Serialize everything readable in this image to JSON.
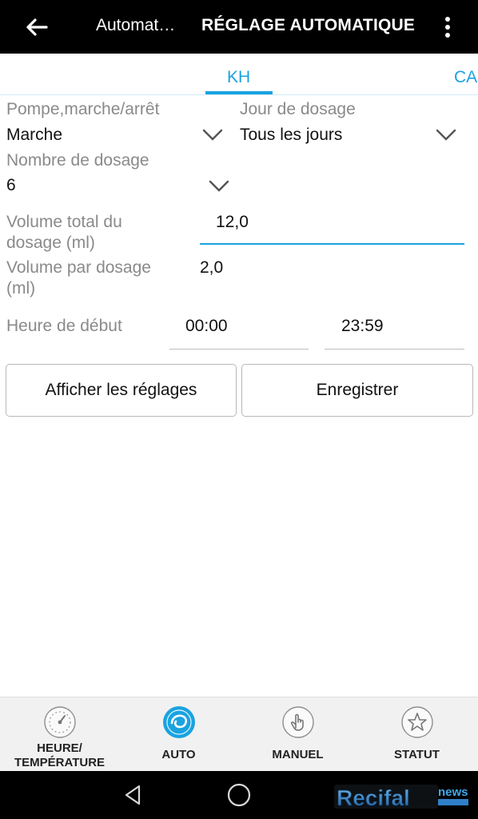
{
  "appbar": {
    "subtitle": "Automat…",
    "title": "RÉGLAGE AUTOMATIQUE",
    "back_icon": "arrow-left-icon",
    "more_icon": "more-vertical-icon"
  },
  "tabs": [
    {
      "label": "KH",
      "selected": true
    },
    {
      "label": "CA",
      "selected": false
    }
  ],
  "form": {
    "pump": {
      "label": "Pompe,marche/arrêt",
      "value": "Marche"
    },
    "day": {
      "label": "Jour de dosage",
      "value": "Tous les jours"
    },
    "count": {
      "label": "Nombre de dosage",
      "value": "6"
    },
    "total_volume": {
      "label_line1": "Volume total du",
      "label_line2": "dosage (ml)",
      "value": "12,0"
    },
    "per_dose": {
      "label_line1": "Volume par dosage",
      "label_line2": "(ml)",
      "value": "2,0"
    },
    "start_time": {
      "label": "Heure de début",
      "from": "00:00",
      "to": "23:59"
    }
  },
  "buttons": {
    "show_settings": "Afficher les réglages",
    "save": "Enregistrer"
  },
  "bottom_nav": [
    {
      "line1": "HEURE/",
      "line2": "TEMPÉRATURE",
      "icon": "gauge-icon",
      "active": false
    },
    {
      "line1": "AUTO",
      "line2": "",
      "icon": "auto-swirl-icon",
      "active": true
    },
    {
      "line1": "MANUEL",
      "line2": "",
      "icon": "hand-pointer-icon",
      "active": false
    },
    {
      "line1": "STATUT",
      "line2": "",
      "icon": "star-icon",
      "active": false
    }
  ],
  "watermark": {
    "brand": "Recifal",
    "suffix": "news"
  },
  "colors": {
    "accent": "#1aa3e0",
    "appbar": "#000000",
    "label": "#8a8a8a",
    "bottom_bar": "#f1f1f1"
  }
}
